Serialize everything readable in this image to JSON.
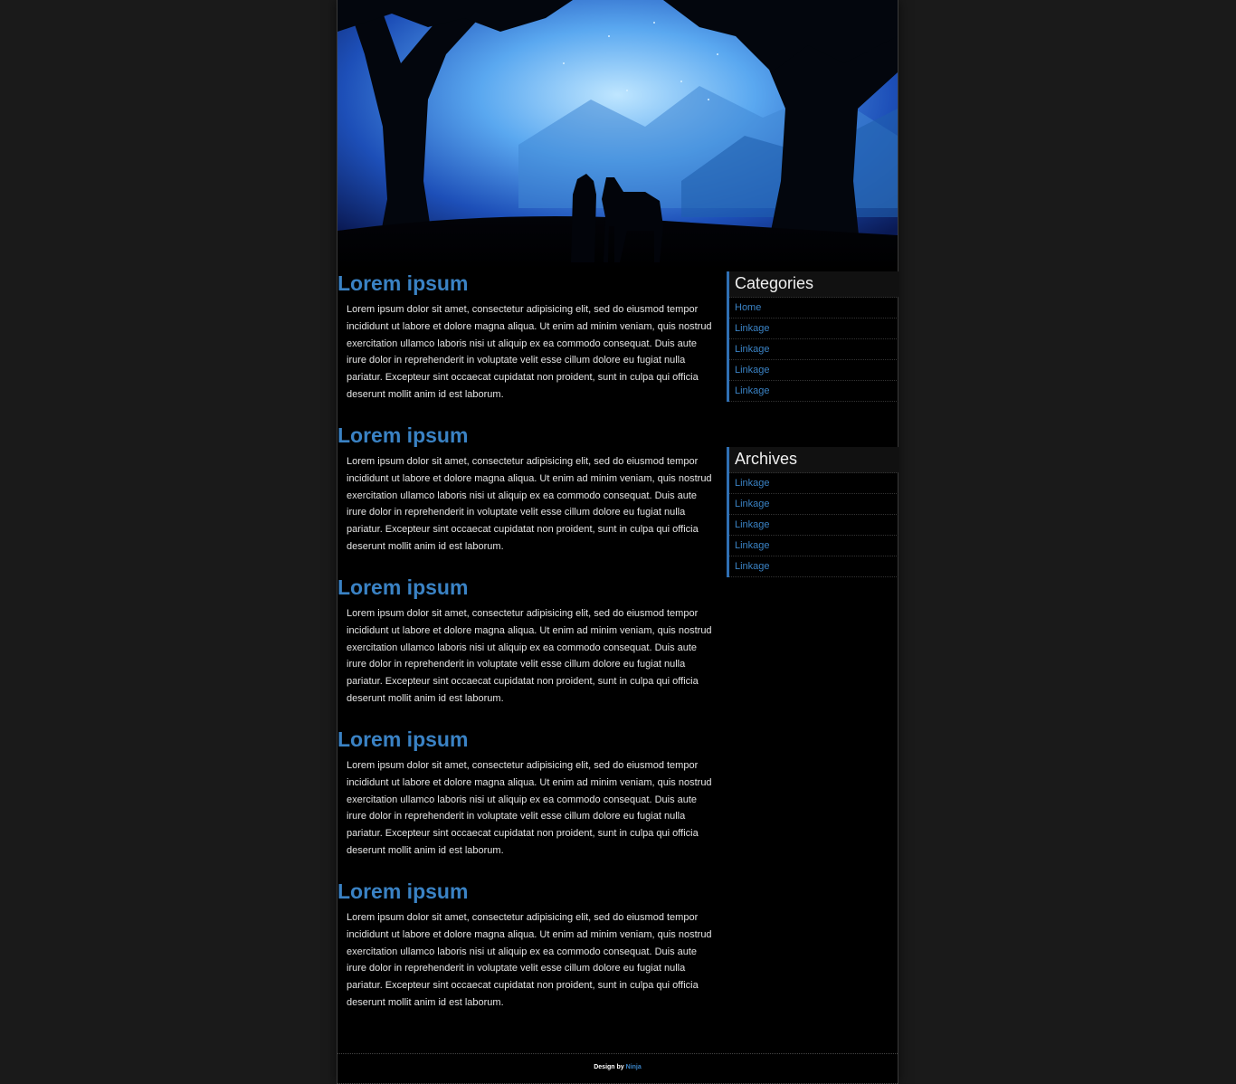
{
  "header": {
    "image": "moonlit-forest-silhouette-banner"
  },
  "posts": [
    {
      "title": "Lorem ipsum",
      "body": "Lorem ipsum dolor sit amet, consectetur adipisicing elit, sed do eiusmod tempor incididunt ut labore et dolore magna aliqua. Ut enim ad minim veniam, quis nostrud exercitation ullamco laboris nisi ut aliquip ex ea commodo consequat. Duis aute irure dolor in reprehenderit in voluptate velit esse cillum dolore eu fugiat nulla pariatur. Excepteur sint occaecat cupidatat non proident, sunt in culpa qui officia deserunt mollit anim id est laborum."
    },
    {
      "title": "Lorem ipsum",
      "body": "Lorem ipsum dolor sit amet, consectetur adipisicing elit, sed do eiusmod tempor incididunt ut labore et dolore magna aliqua. Ut enim ad minim veniam, quis nostrud exercitation ullamco laboris nisi ut aliquip ex ea commodo consequat. Duis aute irure dolor in reprehenderit in voluptate velit esse cillum dolore eu fugiat nulla pariatur. Excepteur sint occaecat cupidatat non proident, sunt in culpa qui officia deserunt mollit anim id est laborum."
    },
    {
      "title": "Lorem ipsum",
      "body": "Lorem ipsum dolor sit amet, consectetur adipisicing elit, sed do eiusmod tempor incididunt ut labore et dolore magna aliqua. Ut enim ad minim veniam, quis nostrud exercitation ullamco laboris nisi ut aliquip ex ea commodo consequat. Duis aute irure dolor in reprehenderit in voluptate velit esse cillum dolore eu fugiat nulla pariatur. Excepteur sint occaecat cupidatat non proident, sunt in culpa qui officia deserunt mollit anim id est laborum."
    },
    {
      "title": "Lorem ipsum",
      "body": "Lorem ipsum dolor sit amet, consectetur adipisicing elit, sed do eiusmod tempor incididunt ut labore et dolore magna aliqua. Ut enim ad minim veniam, quis nostrud exercitation ullamco laboris nisi ut aliquip ex ea commodo consequat. Duis aute irure dolor in reprehenderit in voluptate velit esse cillum dolore eu fugiat nulla pariatur. Excepteur sint occaecat cupidatat non proident, sunt in culpa qui officia deserunt mollit anim id est laborum."
    },
    {
      "title": "Lorem ipsum",
      "body": "Lorem ipsum dolor sit amet, consectetur adipisicing elit, sed do eiusmod tempor incididunt ut labore et dolore magna aliqua. Ut enim ad minim veniam, quis nostrud exercitation ullamco laboris nisi ut aliquip ex ea commodo consequat. Duis aute irure dolor in reprehenderit in voluptate velit esse cillum dolore eu fugiat nulla pariatur. Excepteur sint occaecat cupidatat non proident, sunt in culpa qui officia deserunt mollit anim id est laborum."
    }
  ],
  "sidebar": {
    "categories": {
      "title": "Categories",
      "items": [
        "Home",
        "Linkage",
        "Linkage",
        "Linkage",
        "Linkage"
      ]
    },
    "archives": {
      "title": "Archives",
      "items": [
        "Linkage",
        "Linkage",
        "Linkage",
        "Linkage",
        "Linkage"
      ]
    }
  },
  "footer": {
    "prefix": "Design by ",
    "link": "Ninja"
  },
  "colors": {
    "accent": "#3a82c4",
    "page_bg": "#1a1a1a",
    "content_bg": "#000000",
    "text": "#e4e4e4"
  }
}
